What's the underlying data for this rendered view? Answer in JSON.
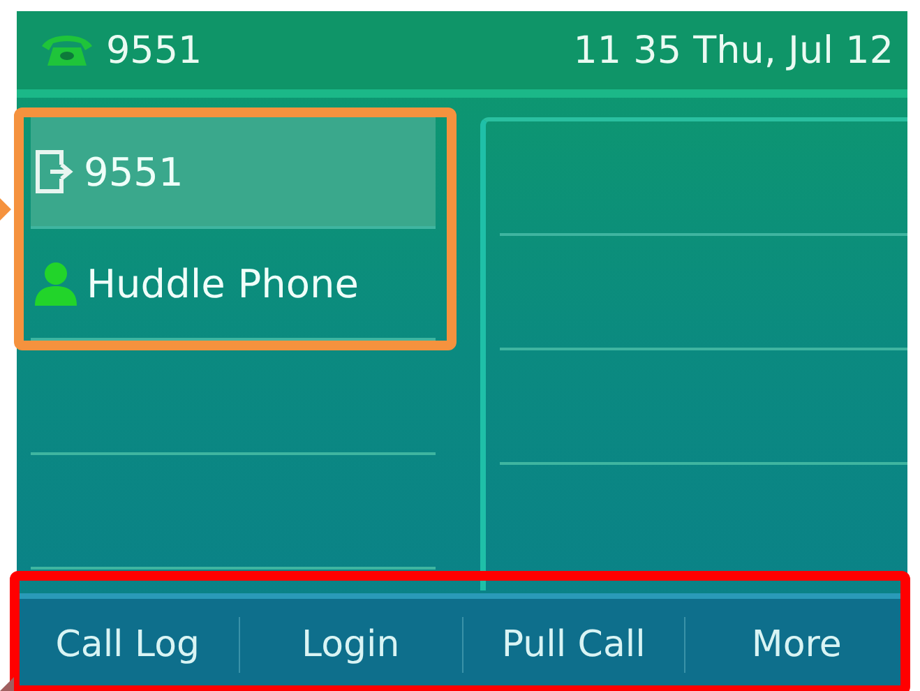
{
  "status_bar": {
    "line": "9551",
    "datetime": "11 35 Thu, Jul 12"
  },
  "lines": [
    {
      "kind": "account",
      "label": "9551",
      "selected": true
    },
    {
      "kind": "contact",
      "label": "Huddle Phone",
      "selected": false
    }
  ],
  "softkeys": [
    "Call Log",
    "Login",
    "Pull Call",
    "More"
  ],
  "annotations": [
    {
      "kind": "lines",
      "color": "#f5923e"
    },
    {
      "kind": "softkeys",
      "color": "#ff0000"
    }
  ]
}
